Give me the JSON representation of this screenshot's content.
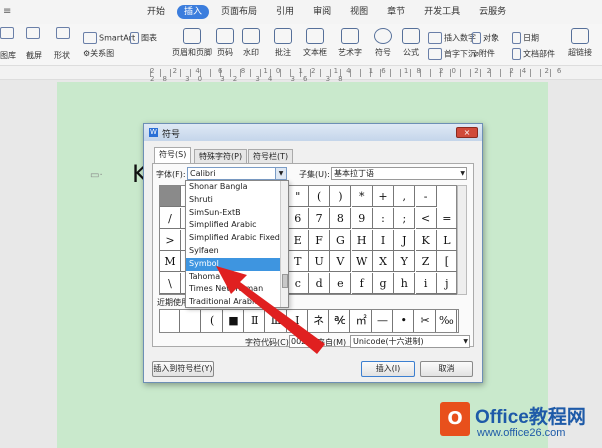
{
  "menubar": {
    "tabs": [
      "开始",
      "插入",
      "页面布局",
      "引用",
      "审阅",
      "视图",
      "章节",
      "开发工具",
      "云服务"
    ],
    "active_tab": "插入"
  },
  "ribbon": {
    "left_items": [
      "图库",
      "截屏",
      "形状",
      "SmartArt",
      "关系图",
      "图表"
    ],
    "buttons": [
      "页眉和页脚",
      "页码",
      "水印",
      "批注",
      "文本框",
      "艺术字",
      "符号",
      "公式"
    ],
    "right_items": [
      "插入数字",
      "对象",
      "日期",
      "首字下沉",
      "附件",
      "文档部件",
      "超链接"
    ]
  },
  "ruler": {
    "numbers": "2 2 4 6 8 10 12 14 16 18 20 22 24 26 28 30 32 34 36 38"
  },
  "document": {
    "text": "K"
  },
  "dialog": {
    "title": "符号",
    "tabs": [
      "符号(S)",
      "特殊字符(P)",
      "符号栏(T)"
    ],
    "font_label": "字体(F):",
    "font_value": "Calibri",
    "subset_label": "子集(U):",
    "subset_value": "基本拉丁语",
    "grid_rows": [
      [
        "",
        "",
        "",
        "",
        "",
        "!",
        "\"",
        "(",
        ")",
        "*",
        "+",
        ",",
        "-"
      ],
      [
        "/",
        "0",
        "",
        "",
        "",
        "5",
        "6",
        "7",
        "8",
        "9",
        ":",
        ";",
        "<",
        "="
      ],
      [
        ">",
        "?",
        "",
        "",
        "",
        "D",
        "E",
        "F",
        "G",
        "H",
        "I",
        "J",
        "K",
        "L"
      ],
      [
        "M",
        "N",
        "",
        "",
        "",
        "S",
        "T",
        "U",
        "V",
        "W",
        "X",
        "Y",
        "Z",
        "["
      ],
      [
        "\\",
        "]",
        "",
        "",
        "",
        "b",
        "c",
        "d",
        "e",
        "f",
        "g",
        "h",
        "i",
        "j"
      ]
    ],
    "font_list": [
      "Shonar Bangla",
      "Shruti",
      "SimSun-ExtB",
      "Simplified Arabic",
      "Simplified Arabic Fixed",
      "Sylfaen",
      "Symbol",
      "Tahoma",
      "Times New Roman",
      "Traditional Arabic"
    ],
    "font_list_selected": "Symbol",
    "recent_label": "近期使用",
    "recent_symbols": [
      "",
      "",
      "(",
      "■",
      "Ⅱ",
      "Ⅲ",
      "Ⅰ",
      "ネ",
      "℀",
      "㎡",
      "—",
      "•",
      "✂",
      "‰"
    ],
    "char_code_label": "字符代码(C):",
    "char_code_value": "0020",
    "from_label": "来自(M)",
    "from_value": "Unicode(十六进制)",
    "insert_to_bar_label": "插入到符号栏(Y)",
    "insert_label": "插入(I)",
    "cancel_label": "取消",
    "close_label": "×"
  },
  "watermark": {
    "logo_letter": "O",
    "title": "Office教程网",
    "url": "www.office26.com"
  },
  "colors": {
    "page": "#c9e9cc",
    "accent": "#3b7ddd",
    "highlight": "#3e95e0",
    "arrow": "#e02020",
    "watermark": "#1e5aa8",
    "logo": "#e8501c"
  }
}
